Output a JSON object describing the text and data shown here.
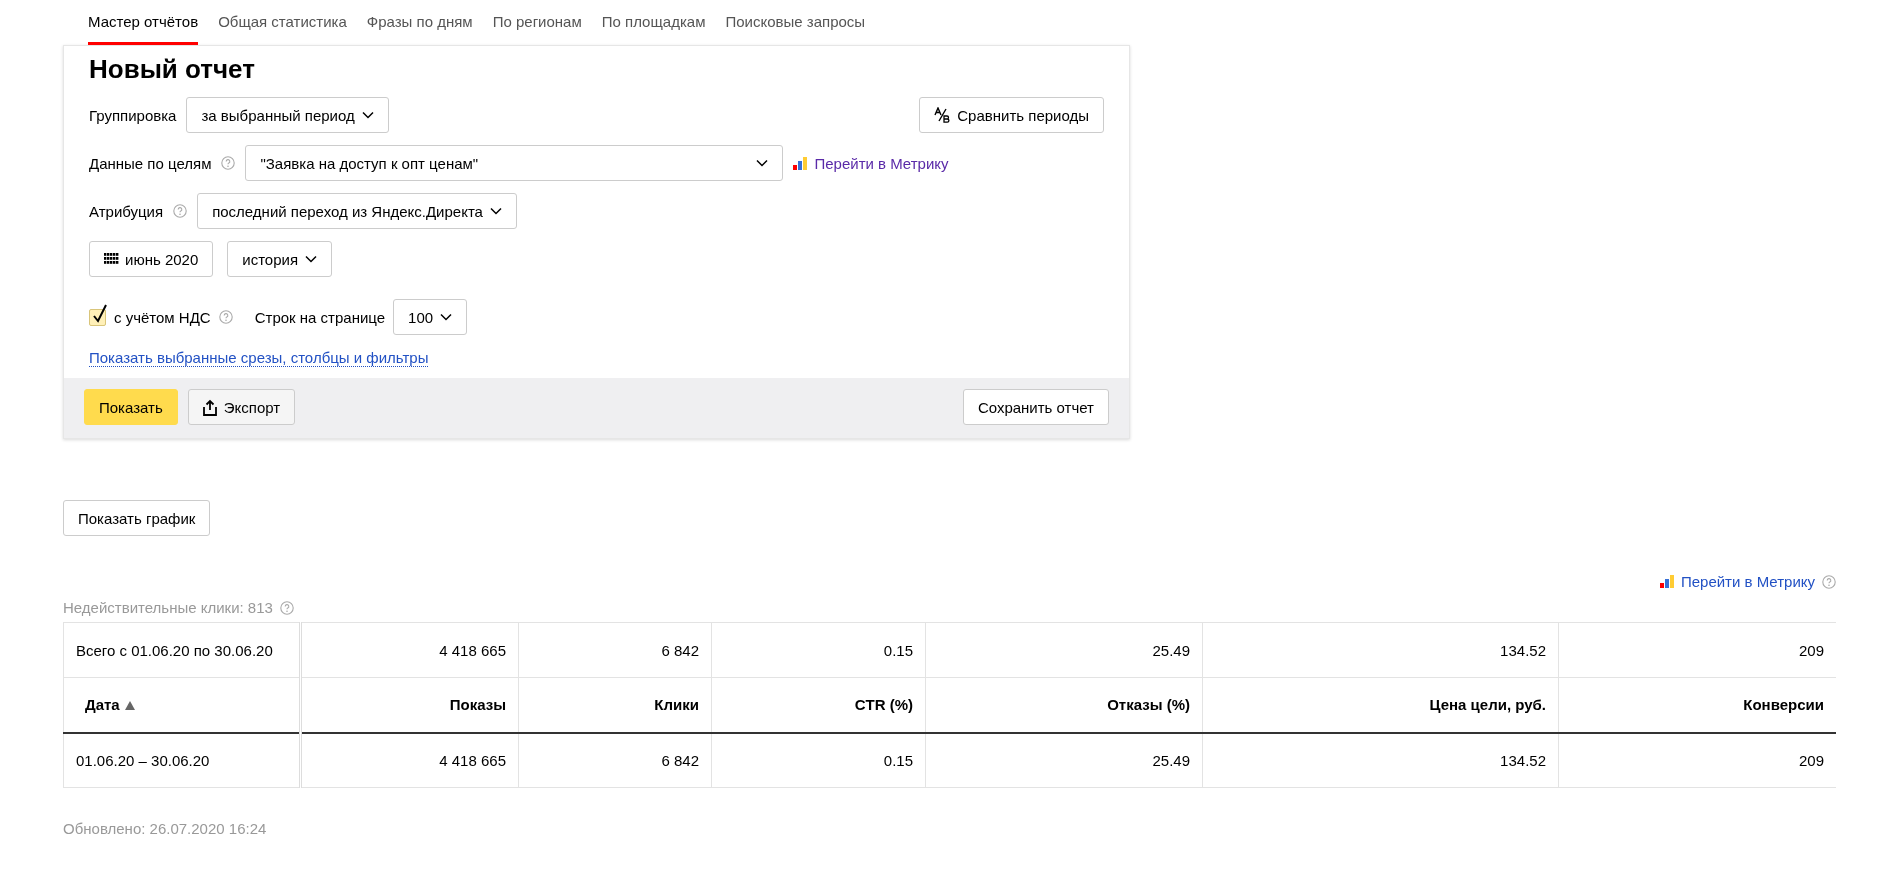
{
  "tabs": [
    {
      "label": "Мастер отчётов",
      "selected": true
    },
    {
      "label": "Общая статистика",
      "selected": false
    },
    {
      "label": "Фразы по дням",
      "selected": false
    },
    {
      "label": "По регионам",
      "selected": false
    },
    {
      "label": "По площадкам",
      "selected": false
    },
    {
      "label": "Поисковые запросы",
      "selected": false
    }
  ],
  "report_form": {
    "title": "Новый отчет",
    "grouping": {
      "label": "Группировка",
      "value": "за выбранный период"
    },
    "compare_button": "Сравнить периоды",
    "goals": {
      "label": "Данные по целям",
      "value": "\"Заявка на доступ к опт ценам\""
    },
    "metrika_link": "Перейти в Метрику",
    "attribution": {
      "label": "Атрибуция",
      "value": "последний переход из Яндекс.Директа"
    },
    "period_button": "июнь 2020",
    "history_dropdown": "история",
    "vat_checkbox": {
      "label": "с учётом НДС",
      "checked": true
    },
    "rows_per_page": {
      "label": "Строк на странице",
      "value": "100"
    },
    "show_filters_link": "Показать выбранные срезы, столбцы и фильтры",
    "show_button": "Показать",
    "export_button": "Экспорт",
    "save_button": "Сохранить отчет"
  },
  "show_chart_button": "Показать график",
  "invalid_clicks": "Недействительные клики: 813",
  "metrika_link": "Перейти в Метрику",
  "table": {
    "total_row": [
      "Всего с 01.06.20 по 30.06.20",
      "4 418 665",
      "6 842",
      "0.15",
      "25.49",
      "134.52",
      "209"
    ],
    "columns": [
      {
        "label": "Дата",
        "sorted": true
      },
      {
        "label": "Показы",
        "sorted": false
      },
      {
        "label": "Клики",
        "sorted": false
      },
      {
        "label": "CTR (%)",
        "sorted": false
      },
      {
        "label": "Отказы (%)",
        "sorted": false
      },
      {
        "label": "Цена цели, руб.",
        "sorted": false
      },
      {
        "label": "Конверсии",
        "sorted": false
      }
    ],
    "rows": [
      [
        "01.06.20 – 30.06.20",
        "4 418 665",
        "6 842",
        "0.15",
        "25.49",
        "134.52",
        "209"
      ]
    ]
  },
  "updated": "Обновлено: 26.07.2020 16:24"
}
